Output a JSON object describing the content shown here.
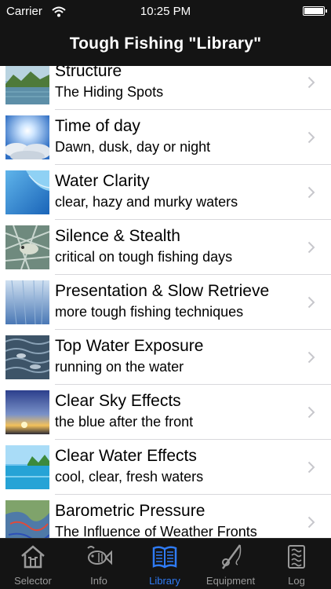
{
  "status_bar": {
    "carrier": "Carrier",
    "time": "10:25 PM"
  },
  "nav": {
    "title": "Tough Fishing \"Library\""
  },
  "items": [
    {
      "title": "Structure",
      "subtitle": "The Hiding Spots"
    },
    {
      "title": "Time of day",
      "subtitle": "Dawn, dusk, day or night"
    },
    {
      "title": "Water Clarity",
      "subtitle": "clear, hazy and murky waters"
    },
    {
      "title": "Silence & Stealth",
      "subtitle": "critical on tough fishing days"
    },
    {
      "title": "Presentation & Slow Retrieve",
      "subtitle": "more tough fishing techniques"
    },
    {
      "title": "Top Water Exposure",
      "subtitle": "running on the water"
    },
    {
      "title": "Clear Sky Effects",
      "subtitle": "the blue after the front"
    },
    {
      "title": "Clear Water Effects",
      "subtitle": "cool, clear, fresh waters"
    },
    {
      "title": "Barometric Pressure",
      "subtitle": "The Influence of Weather Fronts"
    }
  ],
  "tabs": [
    {
      "label": "Selector",
      "icon": "house-icon"
    },
    {
      "label": "Info",
      "icon": "fish-icon"
    },
    {
      "label": "Library",
      "icon": "book-icon",
      "active": true
    },
    {
      "label": "Equipment",
      "icon": "fishing-rod-icon"
    },
    {
      "label": "Log",
      "icon": "log-icon"
    }
  ],
  "colors": {
    "bar_background": "#141414",
    "active_tab": "#2f7bf5",
    "inactive_tab": "#9a9a9a",
    "chevron": "#c7c7cc"
  }
}
